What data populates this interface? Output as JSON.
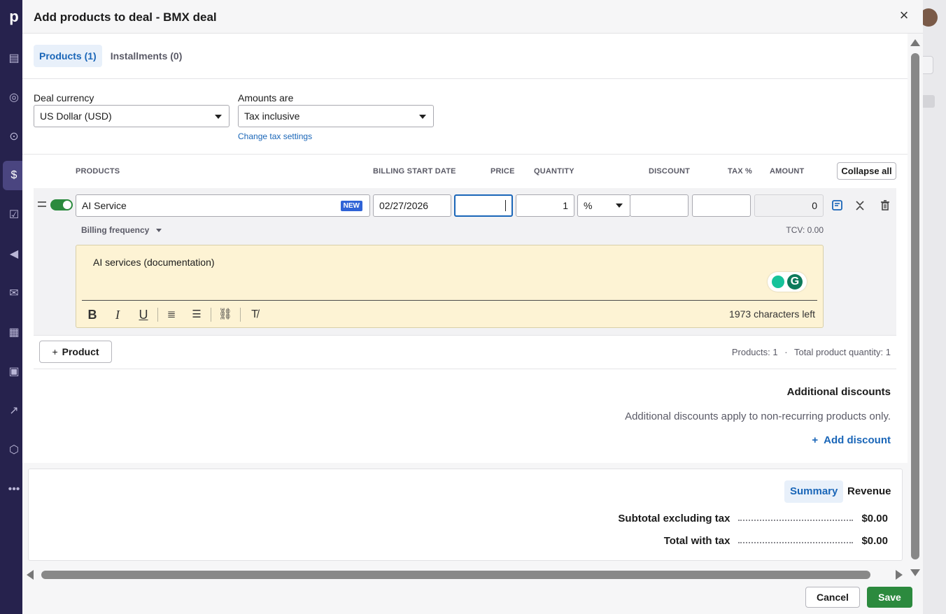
{
  "modal": {
    "title": "Add products to deal - BMX deal",
    "close_icon": "close-icon"
  },
  "tabs": [
    {
      "label": "Products (1)",
      "active": true
    },
    {
      "label": "Installments (0)",
      "active": false
    }
  ],
  "deal_currency": {
    "label": "Deal currency",
    "value": "US Dollar (USD)"
  },
  "amounts_are": {
    "label": "Amounts are",
    "value": "Tax inclusive"
  },
  "change_tax_settings": "Change tax settings",
  "columns": {
    "products": "PRODUCTS",
    "billing_start_date": "BILLING START DATE",
    "price": "PRICE",
    "quantity": "QUANTITY",
    "discount": "DISCOUNT",
    "tax": "TAX %",
    "amount": "AMOUNT"
  },
  "collapse_all": "Collapse all",
  "product_row": {
    "enabled": true,
    "name": "AI Service",
    "badge": "NEW",
    "billing_start_date": "02/27/2026",
    "price": "",
    "quantity": "1",
    "discount_type": "%",
    "discount": "",
    "tax": "",
    "amount": "0",
    "billing_frequency": "Billing frequency",
    "tcv": "TCV: 0.00",
    "description": "AI services (documentation)",
    "chars_left": "1973 characters left"
  },
  "add_product": "Product",
  "products_summary": "Products: 1",
  "separator": "·",
  "total_quantity": "Total product quantity: 1",
  "additional_discounts": {
    "title": "Additional discounts",
    "note": "Additional discounts apply to non-recurring products only.",
    "add_label": "Add discount"
  },
  "summary": {
    "tabs": [
      {
        "label": "Summary",
        "active": true
      },
      {
        "label": "Revenue",
        "active": false
      }
    ],
    "subtotal_label": "Subtotal excluding tax",
    "subtotal_value": "$0.00",
    "total_label": "Total with tax",
    "total_value": "$0.00"
  },
  "footer": {
    "cancel": "Cancel",
    "save": "Save"
  },
  "colors": {
    "accent": "#1a66b8",
    "success": "#2c8a3e",
    "badge": "#2f63d6",
    "editor_bg": "#fdf3d4"
  }
}
